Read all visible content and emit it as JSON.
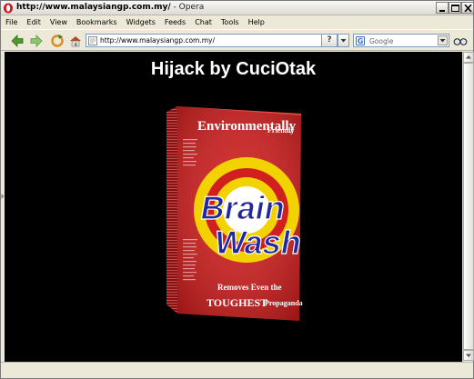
{
  "window": {
    "title_url": "http://www.malaysiangp.com.my/",
    "title_sep": " - ",
    "title_app": "Opera"
  },
  "menu": [
    "File",
    "Edit",
    "View",
    "Bookmarks",
    "Widgets",
    "Feeds",
    "Chat",
    "Tools",
    "Help"
  ],
  "toolbar": {
    "address": "http://www.malaysiangp.com.my/",
    "help_label": "?",
    "search_placeholder": "Google",
    "search_engine_icon": "G"
  },
  "page": {
    "heading": "Hijack by CuciOtak",
    "box": {
      "top_line1": "Environmentally",
      "top_line2": "Friendly",
      "brand_1": "Brain",
      "brand_2": "Wash",
      "bottom_line1": "Removes Even the",
      "bottom_big": "TOUGHEST",
      "bottom_small": "Propaganda"
    }
  },
  "colors": {
    "page_background": "#000000",
    "box_red": "#d11f1f",
    "target_yellow": "#f2d200",
    "brand_blue": "#23289a"
  },
  "icons": [
    "back-arrow-icon",
    "forward-arrow-icon",
    "reload-icon",
    "home-icon",
    "favicon-icon",
    "search-dropdown-icon",
    "zoom-glasses-icon"
  ]
}
